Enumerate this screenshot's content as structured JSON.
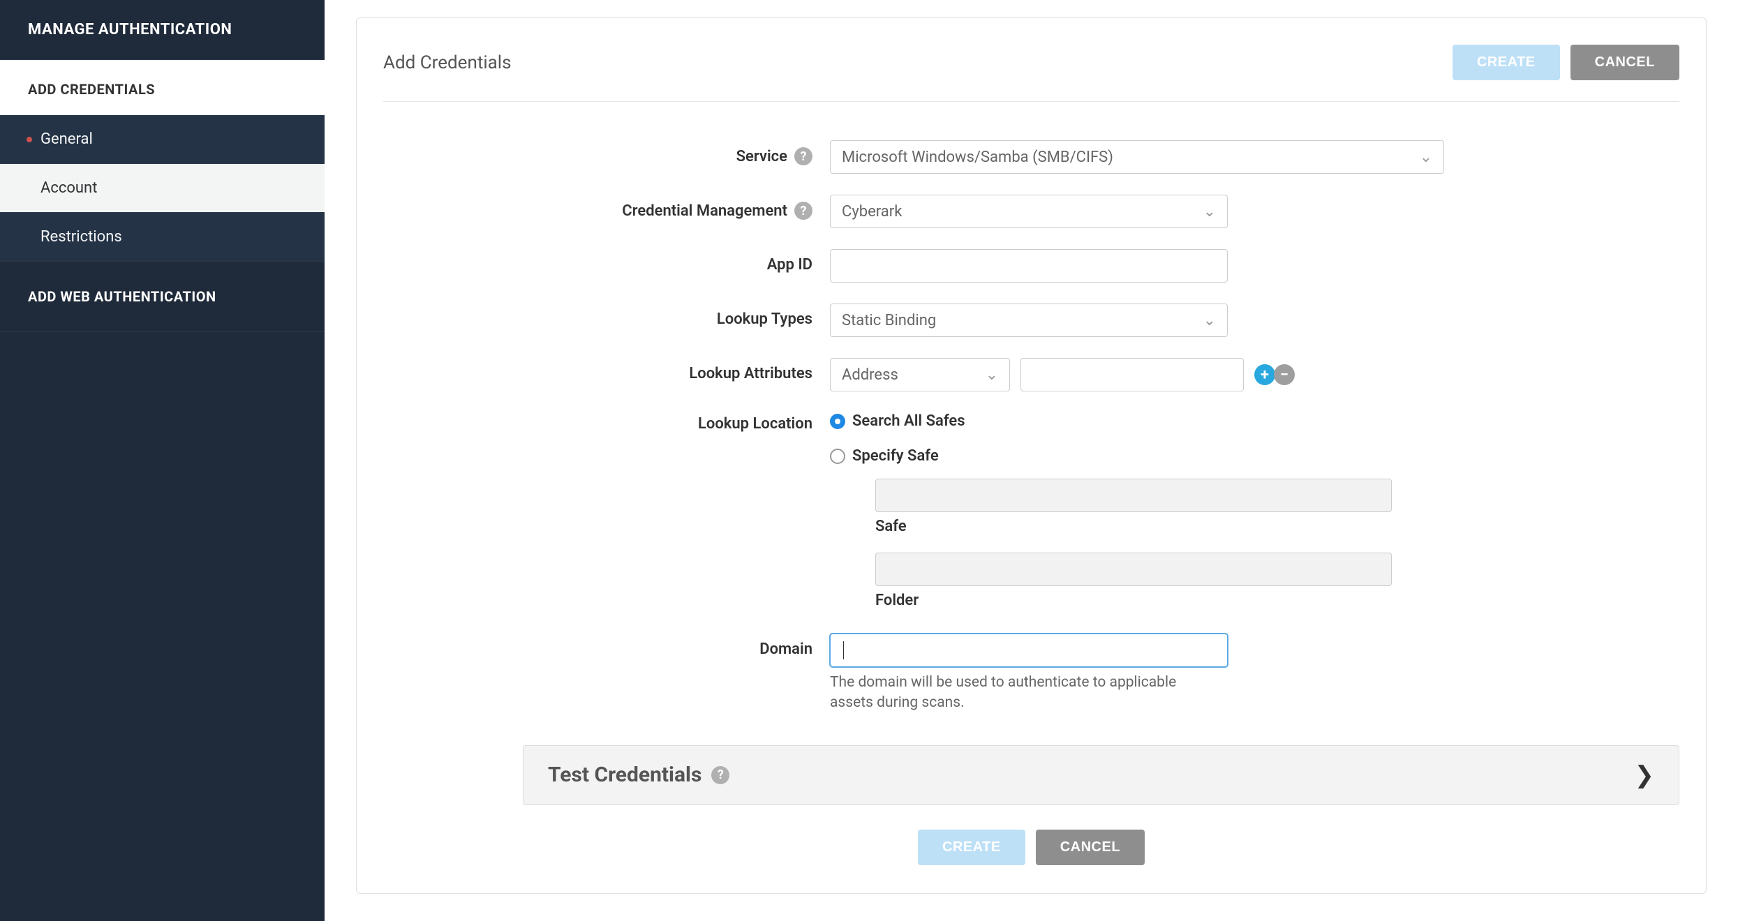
{
  "sidebar": {
    "header": "MANAGE AUTHENTICATION",
    "add_credentials_label": "ADD CREDENTIALS",
    "items": [
      {
        "label": "General",
        "active": false,
        "dot": true
      },
      {
        "label": "Account",
        "active": true,
        "dot": false
      },
      {
        "label": "Restrictions",
        "active": false,
        "dot": false
      }
    ],
    "add_web_auth_label": "ADD WEB AUTHENTICATION"
  },
  "page": {
    "title": "Add Credentials",
    "create_label": "CREATE",
    "cancel_label": "CANCEL"
  },
  "form": {
    "service": {
      "label": "Service",
      "value": "Microsoft Windows/Samba (SMB/CIFS)"
    },
    "credential_management": {
      "label": "Credential Management",
      "value": "Cyberark"
    },
    "app_id": {
      "label": "App ID",
      "value": ""
    },
    "lookup_types": {
      "label": "Lookup Types",
      "value": "Static Binding"
    },
    "lookup_attributes": {
      "label": "Lookup Attributes",
      "select_value": "Address",
      "input_value": ""
    },
    "lookup_location": {
      "label": "Lookup Location",
      "option_search_all": "Search All Safes",
      "option_specify": "Specify Safe",
      "safe_label": "Safe",
      "safe_value": "",
      "folder_label": "Folder",
      "folder_value": ""
    },
    "domain": {
      "label": "Domain",
      "value": "",
      "help": "The domain will be used to authenticate to applicable assets during scans."
    }
  },
  "test_panel": {
    "title": "Test Credentials"
  },
  "icons": {
    "help": "?",
    "plus": "+",
    "minus": "−",
    "chev_down": "⌄",
    "chev_right": "❯"
  }
}
